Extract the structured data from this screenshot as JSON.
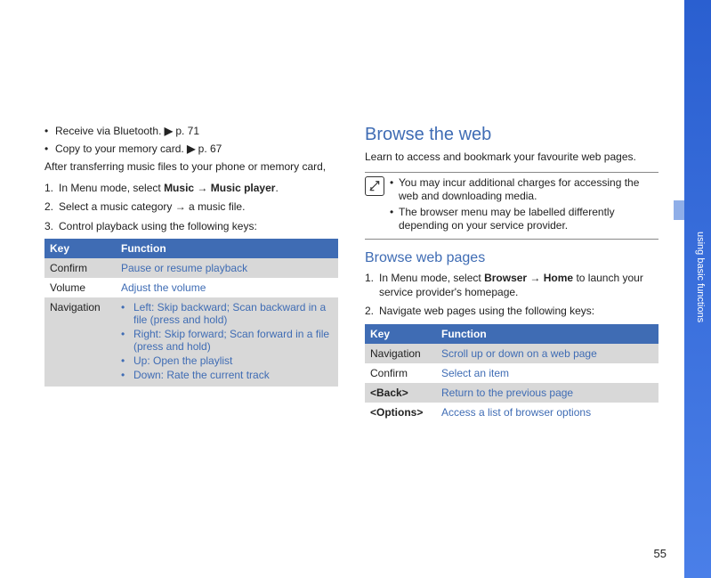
{
  "page_number": "55",
  "side_label": "using basic functions",
  "left": {
    "bullets": [
      {
        "text": "Receive via Bluetooth. ",
        "ref": "▶",
        "page": "p. 71"
      },
      {
        "text": "Copy to your memory card. ",
        "ref": "▶",
        "page": "p. 67"
      }
    ],
    "after_transfer": "After transferring music files to your phone or memory card,",
    "steps": {
      "s1_prefix": "In Menu mode, select ",
      "s1_b1": "Music",
      "s1_arrow": " → ",
      "s1_b2": "Music player",
      "s1_suffix": ".",
      "s2": "Select a music category → a music file.",
      "s3": "Control playback using the following keys:"
    },
    "table": {
      "h_key": "Key",
      "h_func": "Function",
      "rows": [
        {
          "key": "Confirm",
          "func": "Pause or resume playback"
        },
        {
          "key": "Volume",
          "func": "Adjust the volume"
        }
      ],
      "nav_key": "Navigation",
      "nav_items": [
        "Left: Skip backward; Scan backward in a file (press and hold)",
        "Right: Skip forward; Scan forward in a file (press and hold)",
        "Up: Open the playlist",
        "Down: Rate the current track"
      ]
    }
  },
  "right": {
    "h1": "Browse the web",
    "intro": "Learn to access and bookmark your favourite web pages.",
    "note": [
      "You may incur additional charges for accessing the web and downloading media.",
      "The browser menu may be labelled differently depending on your service provider."
    ],
    "h2": "Browse web pages",
    "steps": {
      "s1_prefix": "In Menu mode, select ",
      "s1_b1": "Browser",
      "s1_arrow": " → ",
      "s1_b2": "Home",
      "s1_suffix": " to launch your service provider's homepage.",
      "s2": "Navigate web pages using the following keys:"
    },
    "table": {
      "h_key": "Key",
      "h_func": "Function",
      "rows": [
        {
          "key": "Navigation",
          "func": "Scroll up or down on a web page"
        },
        {
          "key": "Confirm",
          "func": "Select an item"
        }
      ],
      "back_key": "<Back>",
      "back_func": "Return to the previous page",
      "opt_key": "<Options>",
      "opt_func": "Access a list of browser options"
    }
  }
}
